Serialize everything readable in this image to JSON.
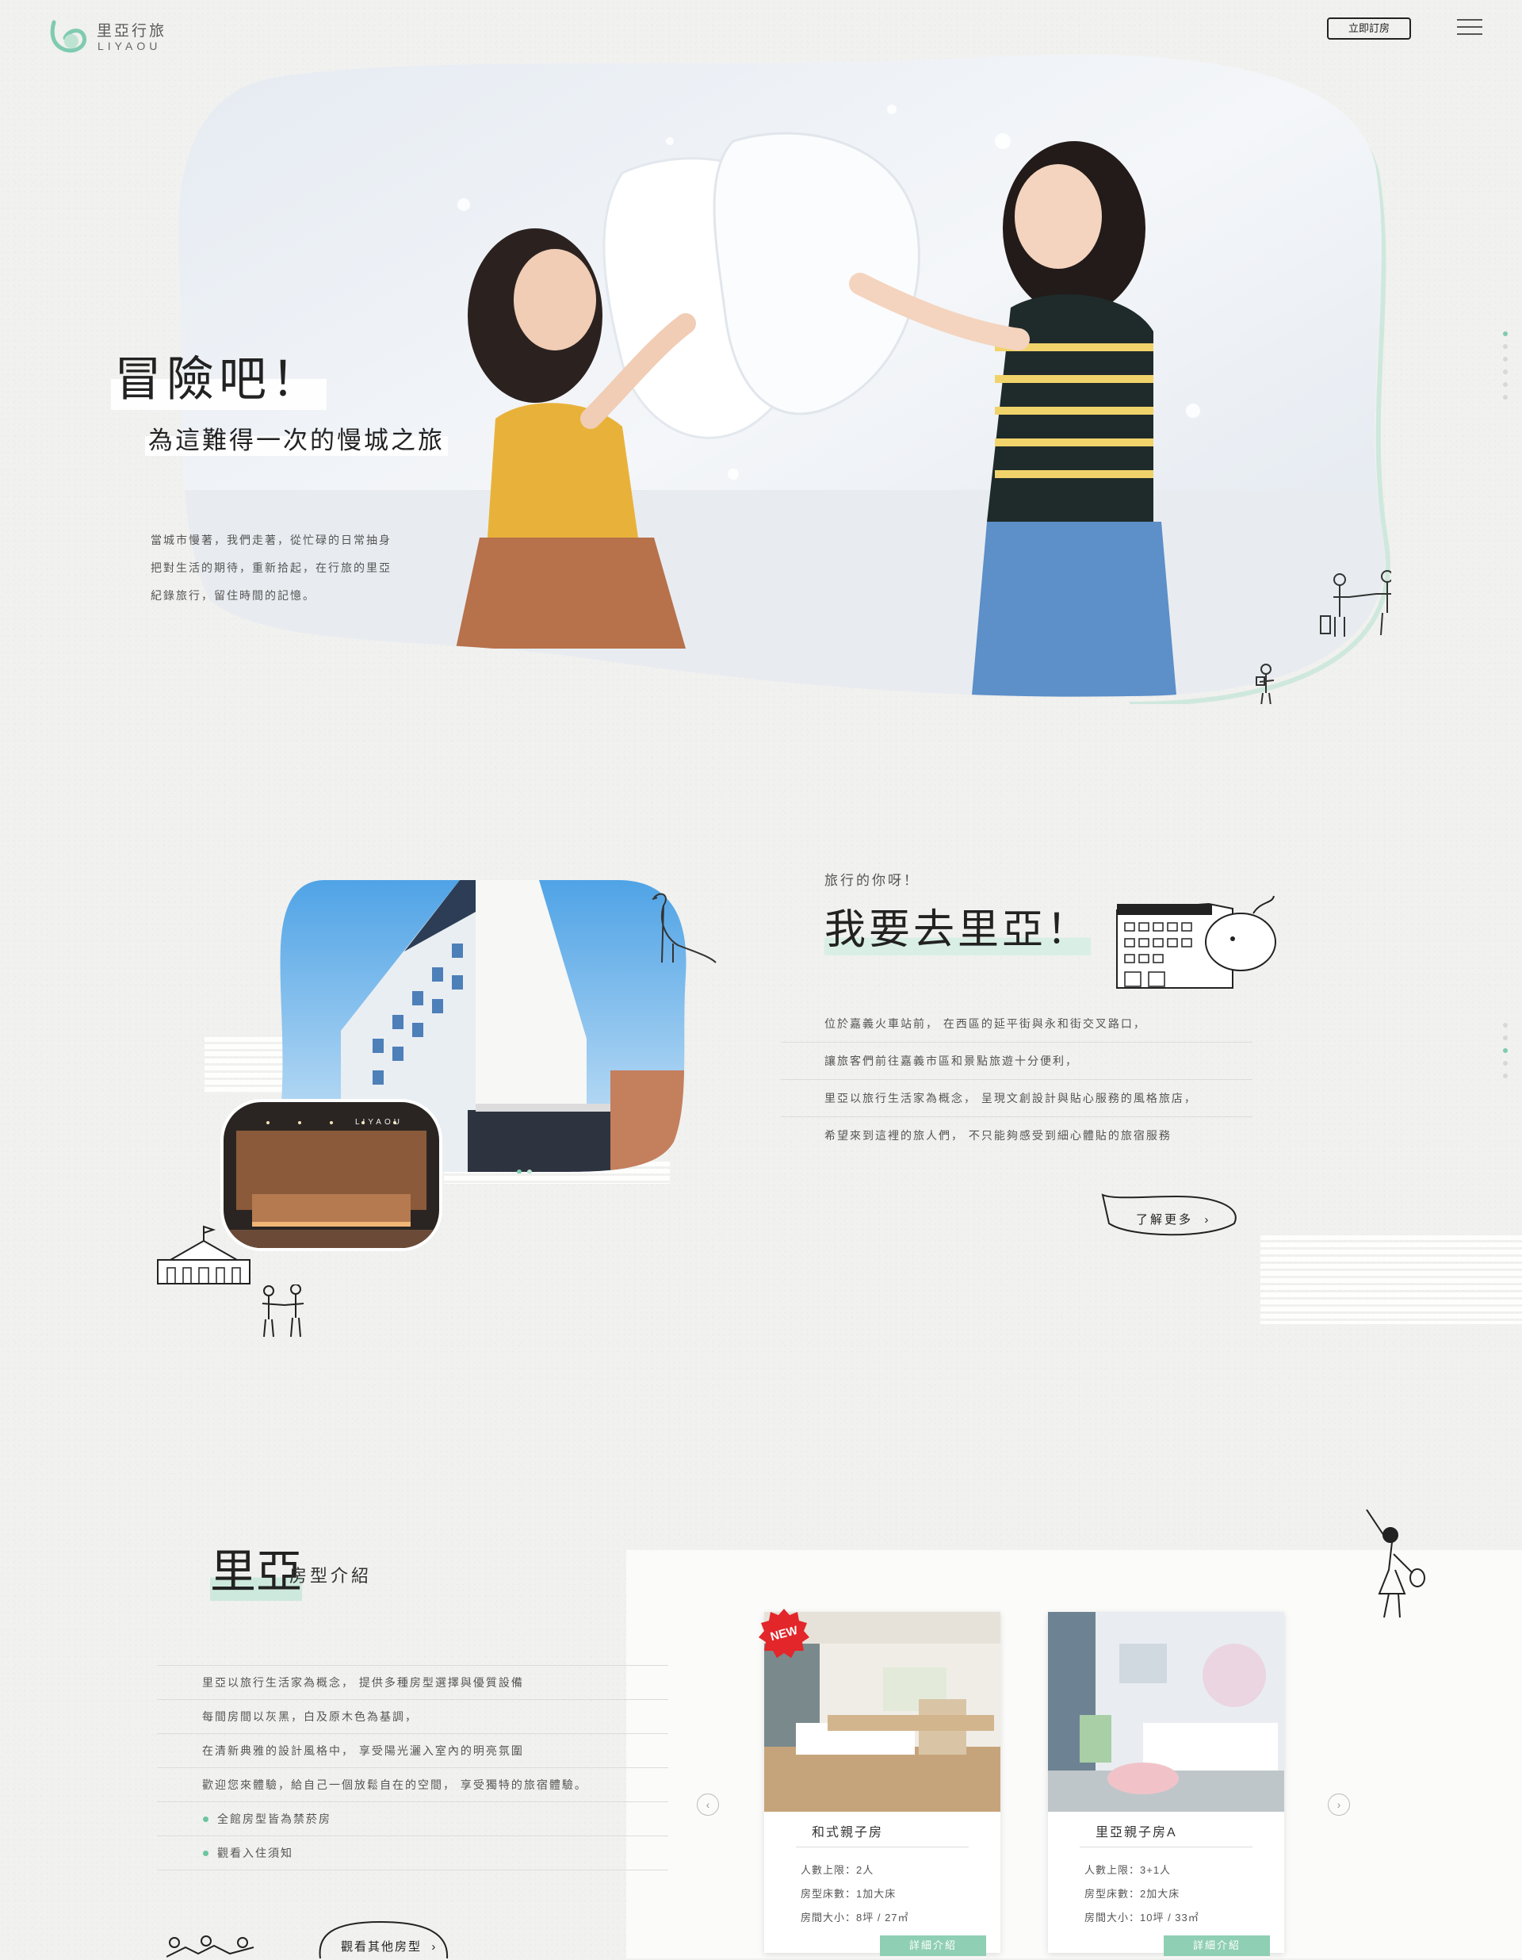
{
  "header": {
    "logo_cn": "里亞行旅",
    "logo_en": "LIYAOU",
    "book_label": "立即訂房"
  },
  "hero": {
    "title": "冒險吧！",
    "subtitle": "為這難得一次的慢城之旅",
    "text": [
      "當城市慢著，我們走著，從忙碌的日常抽身",
      "把對生活的期待，重新拾起，在行旅的里亞",
      "紀錄旅行，留住時間的記憶。"
    ]
  },
  "about": {
    "small": "旅行的你呀！",
    "title": "我要去里亞！",
    "lobby_sign": "LIYAOU",
    "lines": [
      "位於嘉義火車站前， 在西區的延平街與永和街交叉路口，",
      "讓旅客們前往嘉義市區和景點旅遊十分便利，",
      "里亞以旅行生活家為概念， 呈現文創設計與貼心服務的風格旅店，",
      "希望來到這裡的旅人們， 不只能夠感受到細心體貼的旅宿服務"
    ],
    "more_label": "了解更多"
  },
  "rooms": {
    "title": "里亞",
    "subtitle": "房型介紹",
    "lines": [
      "里亞以旅行生活家為概念， 提供多種房型選擇與優質設備",
      "每間房間以灰黑，白及原木色為基調，",
      "在清新典雅的設計風格中， 享受陽光灑入室內的明亮氛圍",
      "歡迎您來體驗，給自己一個放鬆自在的空間， 享受獨特的旅宿體驗。"
    ],
    "dot_items": [
      "全館房型皆為禁菸房",
      "觀看入住須知"
    ],
    "more_label": "觀看其他房型",
    "cards": [
      {
        "badge": "NEW",
        "name": "和式親子房",
        "capacity": "人數上限：2人",
        "beds": "房型床數：1加大床",
        "size": "房間大小：8坪 / 27㎡",
        "detail": "詳細介紹"
      },
      {
        "name": "里亞親子房A",
        "capacity": "人數上限：3+1人",
        "beds": "房型床數：2加大床",
        "size": "房間大小：10坪 / 33㎡",
        "detail": "詳細介紹"
      }
    ]
  },
  "colors": {
    "accent": "#7fcbb1",
    "ink": "#222222",
    "paper": "#f1f1ef"
  },
  "icons": [
    "logo-mark-icon",
    "menu-icon",
    "chevron-left-icon",
    "chevron-right-icon"
  ]
}
